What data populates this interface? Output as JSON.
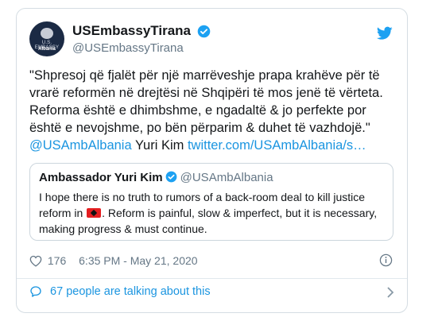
{
  "header": {
    "avatar_line1": "U.S. EMBASSY",
    "avatar_line2": "Albania",
    "display_name": "USEmbassyTirana",
    "handle": "@USEmbassyTirana"
  },
  "tweet": {
    "text": "\"Shpresoj që fjalët për një marrëveshje prapa krahëve për të vrarë reformën në drejtësi në Shqipëri të mos jenë të vërteta. Reforma është e dhimbshme, e ngadaltë & jo perfekte por është e nevojshme, po bën përparim & duhet të vazhdojë.\"",
    "mention": "@USAmbAlbania",
    "author": "Yuri Kim",
    "link": "twitter.com/USAmbAlbania/s…"
  },
  "quote": {
    "name": "Ambassador Yuri Kim",
    "handle": "@USAmbAlbania",
    "text_before": "I hope there is no truth to rumors of a back-room deal to kill justice reform in",
    "text_after": ". Reform is painful, slow & imperfect, but it is necessary, making progress & must continue."
  },
  "meta": {
    "likes": "176",
    "timestamp": "6:35 PM - May 21, 2020"
  },
  "footer": {
    "talking": "67 people are talking about this"
  },
  "colors": {
    "link": "#1b95e0",
    "text": "#14171a",
    "muted": "#657786"
  }
}
